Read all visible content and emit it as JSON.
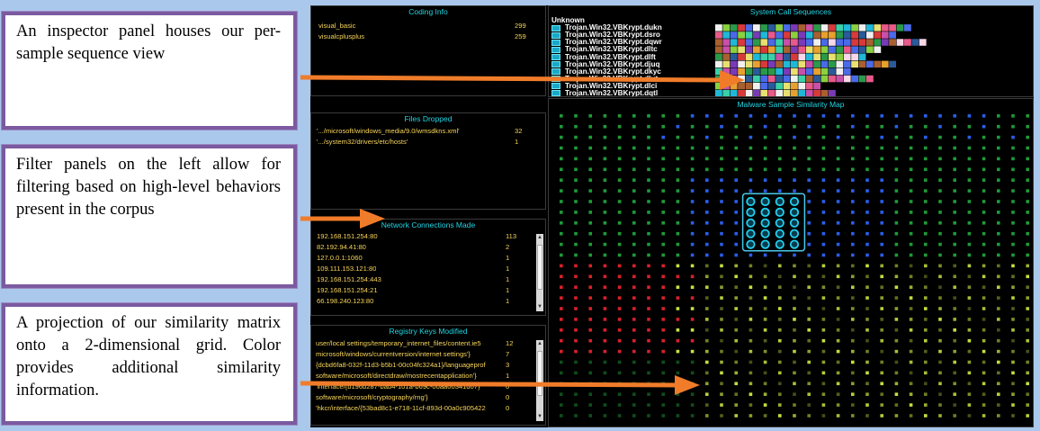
{
  "callouts": {
    "c1": "An inspector panel houses our per-sample sequence view",
    "c2": "Filter panels on the left allow for filtering based on high-level behaviors present in the corpus",
    "c3": "A projection of our similarity matrix onto a 2-dimensional grid. Color provides additional similarity information."
  },
  "coding_info": {
    "title": "Coding Info",
    "rows": [
      {
        "label": "visual_basic",
        "count": "299"
      },
      {
        "label": "visualcplusplus",
        "count": "259"
      }
    ]
  },
  "files_dropped": {
    "title": "Files Dropped",
    "rows": [
      {
        "label": "'.../microsoft/windows_media/9.0/wmsdkns.xml'",
        "count": "32"
      },
      {
        "label": "'.../system32/drivers/etc/hosts'",
        "count": "1"
      }
    ]
  },
  "network_connections": {
    "title": "Network Connections Made",
    "rows": [
      {
        "label": "192.168.151.254:80",
        "count": "113"
      },
      {
        "label": "82.192.94.41:80",
        "count": "2"
      },
      {
        "label": "127.0.0.1:1060",
        "count": "1"
      },
      {
        "label": "109.111.153.121:80",
        "count": "1"
      },
      {
        "label": "192.168.151.254:443",
        "count": "1"
      },
      {
        "label": "192.168.151.254:21",
        "count": "1"
      },
      {
        "label": "66.198.240.123:80",
        "count": "1"
      }
    ]
  },
  "registry_keys": {
    "title": "Registry Keys Modified",
    "rows": [
      {
        "label": "user/local settings/temporary_internet_files/content.ie5",
        "count": "12"
      },
      {
        "label": "microsoft/windows/currentversion/internet settings'}",
        "count": "7"
      },
      {
        "label": "{dcbd6fa8-032f-11d3-b5b1-00c04fc324a1}/languageprof",
        "count": "3"
      },
      {
        "label": "software/microsoft/directdraw/mostrecentapplication'}",
        "count": "1"
      },
      {
        "label": "'interface/{b196b287-bab4-101a-b69c-00aa00341d07}",
        "count": "0"
      },
      {
        "label": "software/microsoft/cryptography/rng'}",
        "count": "0"
      },
      {
        "label": "'hkcr/interface/{53bad8c1-e718-11cf-893d-00a0c905422",
        "count": "0"
      }
    ]
  },
  "system_calls": {
    "title": "System Call Sequences",
    "samples": [
      "Unknown",
      "Trojan.Win32.VBKrypt.dukn",
      "Trojan.Win32.VBKrypt.dsro",
      "Trojan.Win32.VBKrypt.dqwr",
      "Trojan.Win32.VBKrypt.dltc",
      "Trojan.Win32.VBKrypt.dlft",
      "Trojan.Win32.VBKrypt.djuq",
      "Trojan.Win32.VBKrypt.dkyc",
      "Trojan.Win32.VBKrypt.dlut",
      "Trojan.Win32.VBKrypt.dlci",
      "Trojan.Win32.VBKrypt.dqtl"
    ]
  },
  "similarity_map": {
    "title": "Malware Sample Similarity Map",
    "colors": {
      "green": "#1e9a38",
      "blue": "#2a5ee8",
      "cyan": "#20d0f0",
      "red": "#d8202a",
      "lime": "#c8e040",
      "selection": "#49c8e8"
    }
  }
}
